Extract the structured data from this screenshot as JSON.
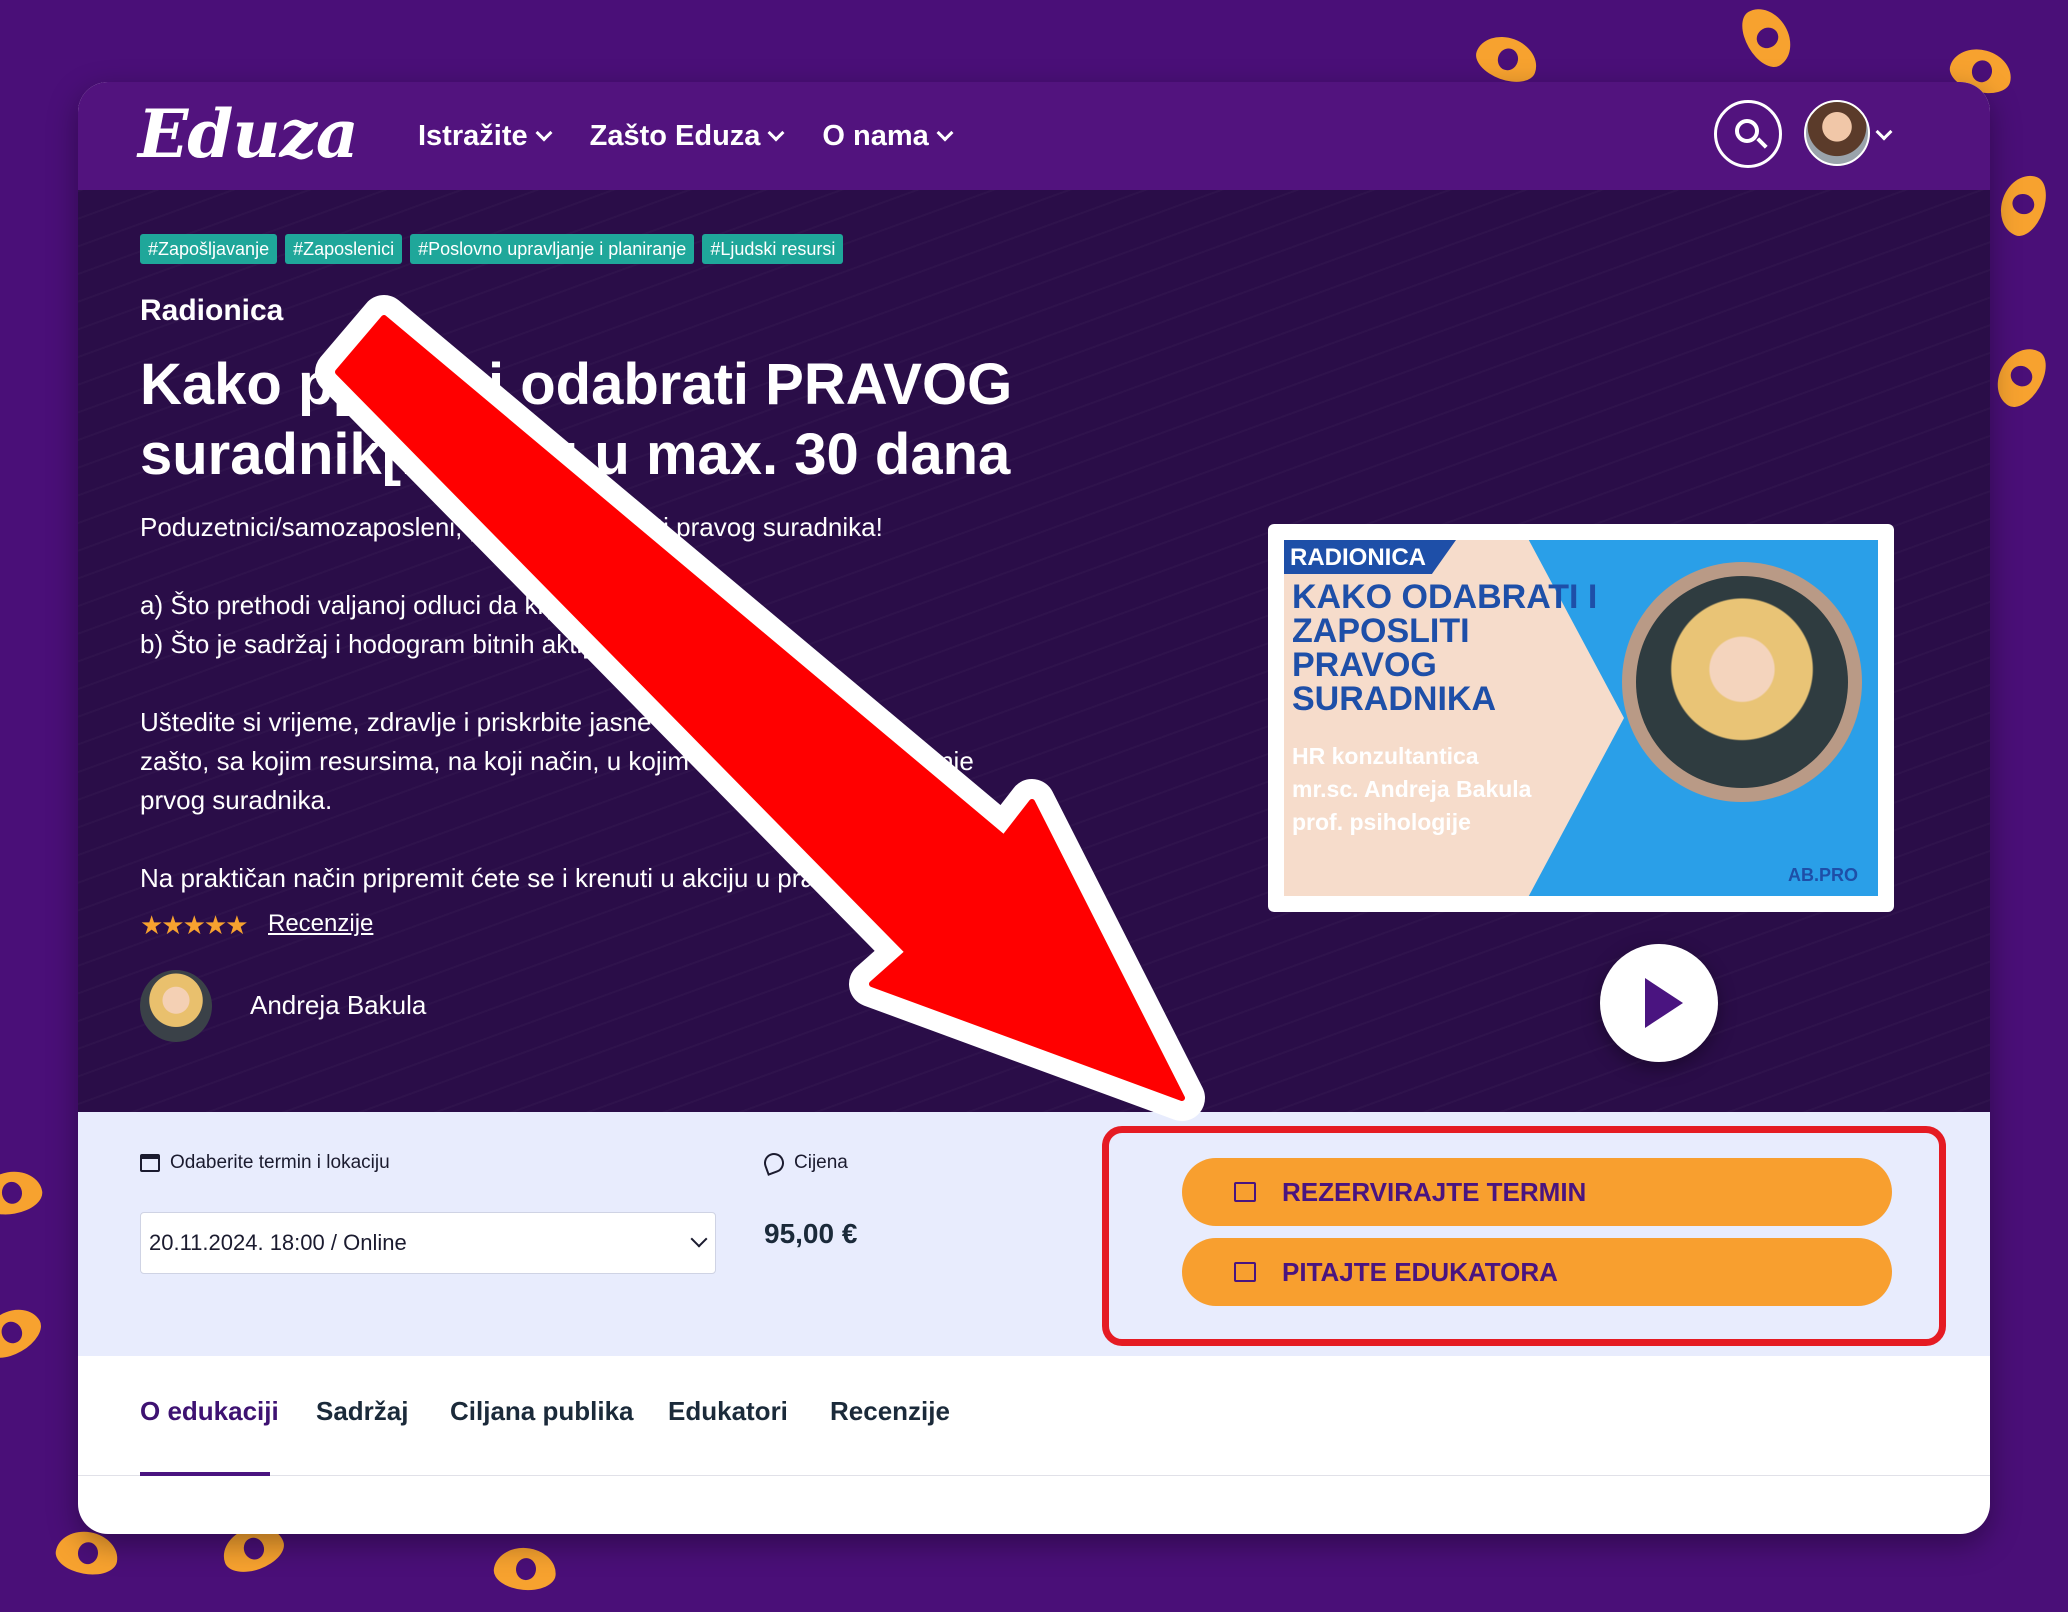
{
  "nav": {
    "logo": "Eduza",
    "items": [
      {
        "label": "Istražite"
      },
      {
        "label": "Zašto Eduza"
      },
      {
        "label": "O nama"
      }
    ]
  },
  "hero": {
    "tags": [
      "#Zapošljavanje",
      "#Zaposlenici",
      "#Poslovno upravljanje i planiranje",
      "#Ljudski resursi"
    ],
    "type": "Radionica",
    "title_line1": "Kako p[...]iti i odabrati PRAVOG",
    "title_line2": "suradnik[...]rtku u max. 30 dana",
    "desc": [
      "Poduzetnici/samozaposleni, [...] kako zaposliti pravog suradnika!",
      "a) Što prethodi valjanoj odluci da kr[...]nje",
      "b) Što je sadržaj i hodogram bitnih akti[...]",
      "Uštedite si vrijeme, zdravlje i priskrbite jasne o[...]nja:",
      "zašto, sa kojim resursima, na koji način, u kojim ro[...]vesti zapošljavanje",
      "prvog suradnika.",
      "Na praktičan način pripremit ćete se i krenuti u akciju u pravo[...]! :)"
    ],
    "stars": "★★★★★",
    "reviews_link": "Recenzije",
    "educator": "Andreja Bakula"
  },
  "video": {
    "badge": "RADIONICA",
    "title": "KAKO ODABRATI I ZAPOSLITI PRAVOG SURADNIKA",
    "subtitle_1": "HR konzultantica",
    "subtitle_2": "mr.sc. Andreja Bakula",
    "subtitle_3": "prof. psihologije",
    "brand": "AB.PRO"
  },
  "booking": {
    "date_label": "Odaberite termin i lokaciju",
    "date_value": "20.11.2024. 18:00 / Online",
    "price_label": "Cijena",
    "price": "95,00 €",
    "reserve_button": "REZERVIRAJTE TERMIN",
    "ask_button": "PITAJTE EDUKATORA"
  },
  "tabs": [
    "O edukaciji",
    "Sadržaj",
    "Ciljana publika",
    "Edukatori",
    "Recenzije"
  ],
  "colors": {
    "brand_purple": "#52137e",
    "accent_orange": "#f89f2f",
    "tag_teal": "#1fa79a",
    "annotation_red": "#e51b23"
  }
}
